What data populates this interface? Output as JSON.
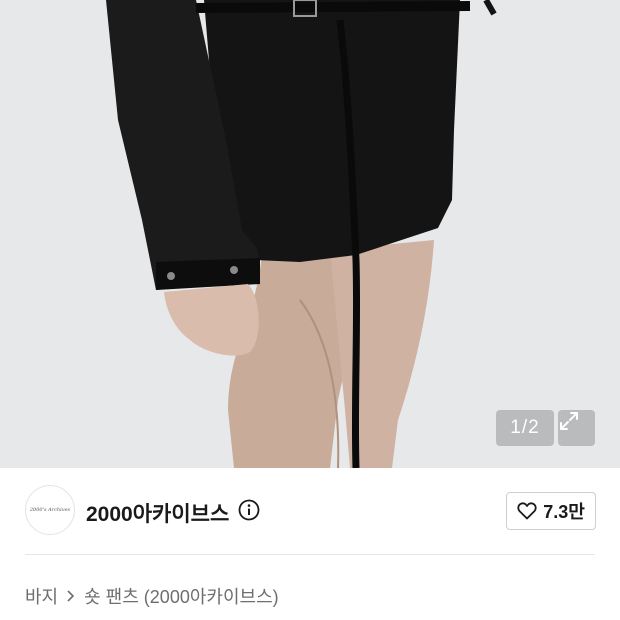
{
  "gallery": {
    "current_page": 1,
    "total_pages": 2,
    "counter_text": "1/2"
  },
  "brand": {
    "name": "2000아카이브스",
    "logo_text": "2000's Archives"
  },
  "like": {
    "count": "7.3만"
  },
  "breadcrumb": {
    "category": "바지",
    "separator": ">",
    "product": "숏 팬츠 (2000아카이브스)"
  },
  "icons": {
    "expand": "expand-icon",
    "info": "info-icon",
    "heart": "heart-icon",
    "chevron": "chevron-right-icon"
  },
  "colors": {
    "background": "#ffffff",
    "text_primary": "#1a1a1a",
    "text_secondary": "#6e6e6e"
  }
}
